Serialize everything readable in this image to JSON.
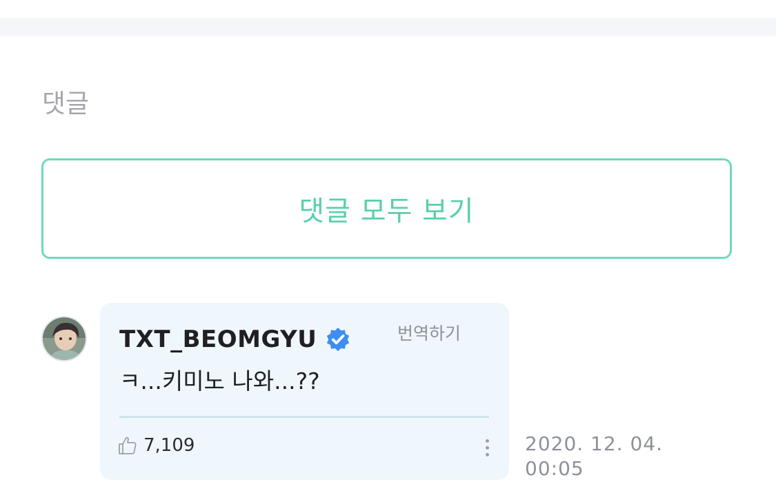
{
  "section": {
    "title": "댓글"
  },
  "view_all_button": {
    "label": "댓글 모두 보기"
  },
  "comment": {
    "author": "TXT_BEOMGYU",
    "verified_icon": "verified-badge-icon",
    "translate_label": "번역하기",
    "text": "ㅋ...키미노 나와...??",
    "like_count": "7,109",
    "like_icon": "thumbs-up-icon",
    "more_icon": "vertical-ellipsis-icon",
    "date": "2020. 12. 04.",
    "time": "00:05"
  },
  "colors": {
    "accent": "#58cfab",
    "accent_border": "#6fd9bd",
    "bubble_bg": "#f0f7fc",
    "verified": "#3d8ef0"
  }
}
